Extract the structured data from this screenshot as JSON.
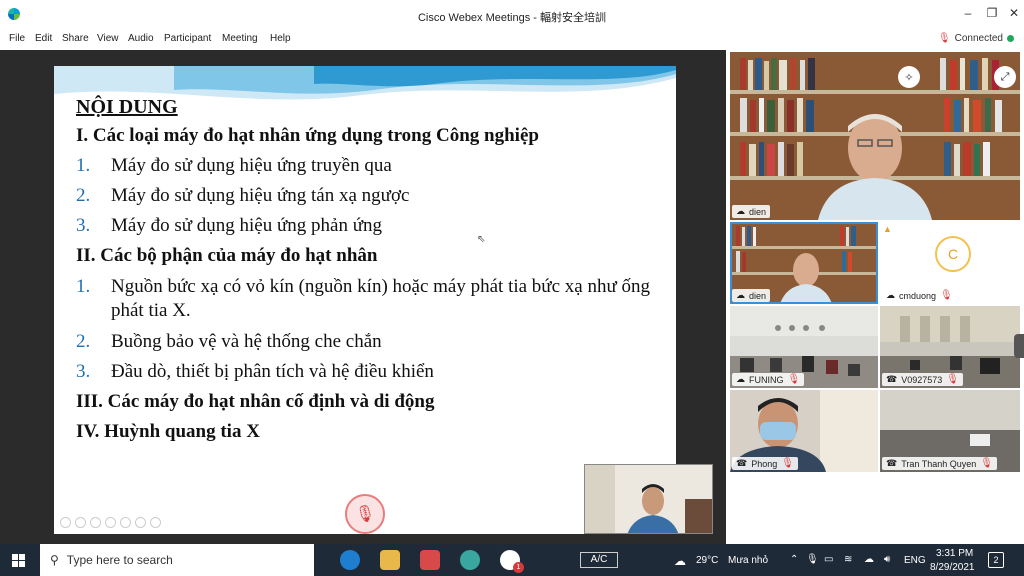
{
  "window": {
    "title": "Cisco Webex Meetings - 輻射安全培訓",
    "controls": {
      "minimize": "–",
      "maximize": "❐",
      "close": "✕"
    }
  },
  "menu": [
    "File",
    "Edit",
    "Share",
    "View",
    "Audio",
    "Participant",
    "Meeting",
    "Help"
  ],
  "status": {
    "text": "Connected",
    "color": "#1fa75a"
  },
  "slide": {
    "heading": "NỘI DUNG",
    "sections": [
      {
        "title": "I. Các loại máy đo hạt nhân ứng dụng trong Công nghiệp",
        "items": [
          {
            "n": "1.",
            "text": "Máy đo sử dụng hiệu ứng truyền qua"
          },
          {
            "n": "2.",
            "text": "Máy đo sử dụng hiệu ứng tán xạ ngược"
          },
          {
            "n": "3.",
            "text": "Máy đo sử dụng hiệu ứng phản ứng"
          }
        ]
      },
      {
        "title": "II. Các bộ phận của máy đo hạt nhân",
        "items": [
          {
            "n": "1.",
            "text": "Nguồn bức xạ có vỏ kín (nguồn kín) hoặc máy phát tia bức xạ như ống phát tia X."
          },
          {
            "n": "2.",
            "text": "Buồng bảo vệ và hệ thống che chắn"
          },
          {
            "n": "3.",
            "text": "Đầu dò, thiết bị phân tích và hệ điều khiển"
          }
        ]
      },
      {
        "title": "III. Các máy đo hạt nhân cố định và di động",
        "items": []
      },
      {
        "title": "IV. Huỳnh quang tia X",
        "items": []
      }
    ]
  },
  "participants": {
    "active_speaker": "dien",
    "tiles": [
      {
        "name": "dien"
      },
      {
        "name": "cmduong",
        "initial": "C"
      },
      {
        "name": "FUNING"
      },
      {
        "name": "V0927573"
      },
      {
        "name": "Phong"
      },
      {
        "name": "Tran Thanh Quyen"
      }
    ]
  },
  "taskbar": {
    "search_placeholder": "Type here to search",
    "ac_label": "A/C",
    "weather": "29°C",
    "weather_desc": "Mưa nhỏ",
    "lang": "ENG",
    "time": "3:31 PM",
    "date": "8/29/2021",
    "notification_count": "2",
    "zoom_badge": "1"
  },
  "colors": {
    "accent_blue": "#1f6fb0",
    "mute_red": "#d8393a",
    "taskbar": "#1f2a38"
  }
}
